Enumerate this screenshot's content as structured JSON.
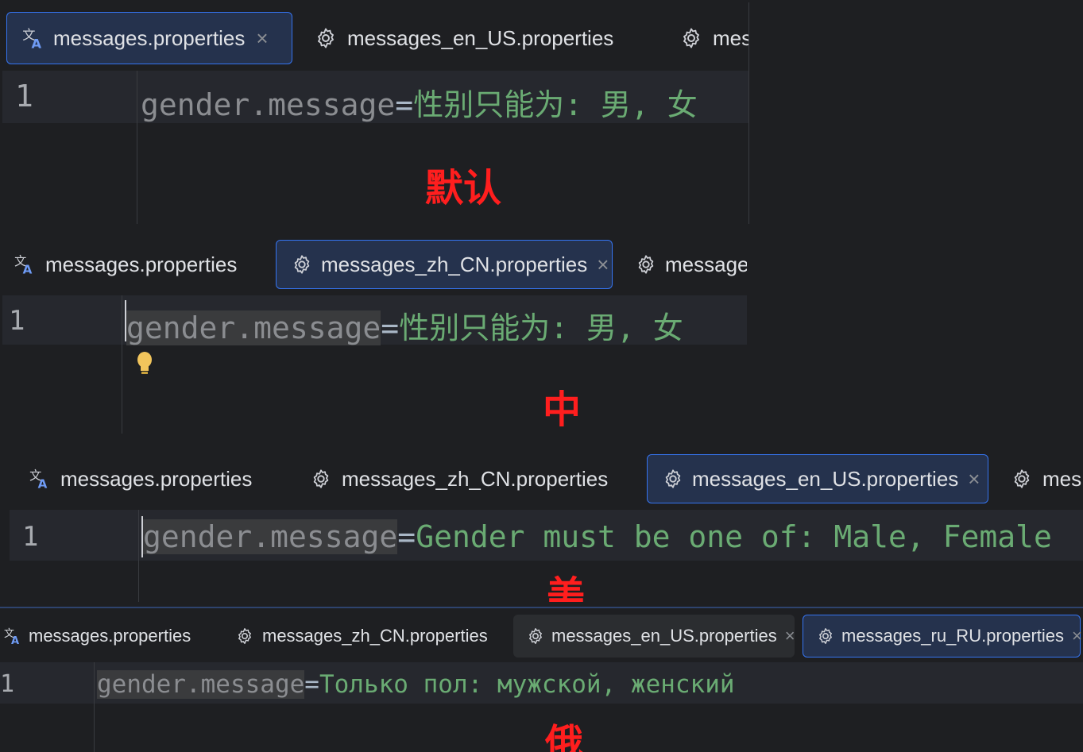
{
  "panels": [
    {
      "tabs": [
        {
          "label": "messages.properties",
          "icon": "translate-icon",
          "active": true,
          "close": "×"
        },
        {
          "label": "messages_en_US.properties",
          "icon": "gear-icon",
          "active": false
        },
        {
          "label": "mes",
          "icon": "gear-icon",
          "active": false
        }
      ],
      "line_number": "1",
      "code": {
        "key": "gender.message",
        "eq": "=",
        "value": "性别只能为: 男, 女"
      },
      "annotation": "默认"
    },
    {
      "tabs": [
        {
          "label": "messages.properties",
          "icon": "translate-icon",
          "active": false
        },
        {
          "label": "messages_zh_CN.properties",
          "icon": "gear-icon",
          "active": true,
          "close": "×"
        },
        {
          "label": "message",
          "icon": "gear-icon",
          "active": false
        }
      ],
      "line_number": "1",
      "code": {
        "key": "gender.message",
        "eq": "=",
        "value": "性别只能为: 男, 女"
      },
      "annotation": "中"
    },
    {
      "tabs": [
        {
          "label": "messages.properties",
          "icon": "translate-icon",
          "active": false
        },
        {
          "label": "messages_zh_CN.properties",
          "icon": "gear-icon",
          "active": false
        },
        {
          "label": "messages_en_US.properties",
          "icon": "gear-icon",
          "active": true,
          "close": "×"
        },
        {
          "label": "mes",
          "icon": "gear-icon",
          "active": false
        }
      ],
      "line_number": "1",
      "code": {
        "key": "gender.message",
        "eq": "=",
        "value": "Gender must be one of: Male, Female"
      },
      "annotation": "美"
    },
    {
      "tabs": [
        {
          "label": "messages.properties",
          "icon": "translate-icon",
          "active": false
        },
        {
          "label": "messages_zh_CN.properties",
          "icon": "gear-icon",
          "active": false
        },
        {
          "label": "messages_en_US.properties",
          "icon": "gear-icon",
          "active": false,
          "close": "×"
        },
        {
          "label": "messages_ru_RU.properties",
          "icon": "gear-icon",
          "active": true,
          "close": "×"
        }
      ],
      "line_number": "1",
      "code": {
        "key": "gender.message",
        "eq": "=",
        "value": "Только пол: мужской, женский"
      },
      "annotation": "俄"
    }
  ],
  "colors": {
    "accent": "#3574f0",
    "annotation": "#ff1e1e",
    "string": "#6aab73"
  }
}
